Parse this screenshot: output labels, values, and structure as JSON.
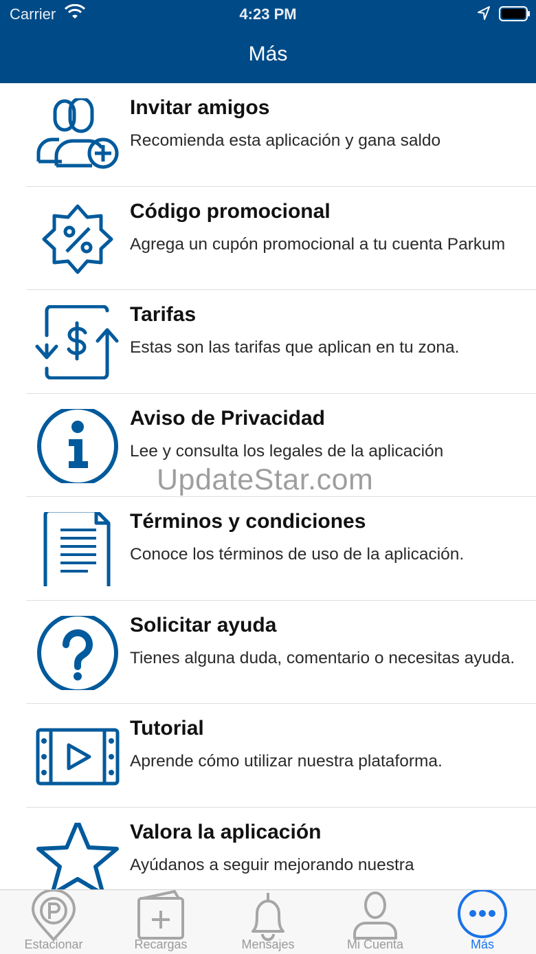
{
  "status": {
    "carrier": "Carrier",
    "time": "4:23 PM"
  },
  "header": {
    "title": "Más"
  },
  "watermark": "UpdateStar.com",
  "colors": {
    "header": "#004b87",
    "icon": "#005a9c",
    "active_tab": "#1a73e8"
  },
  "items": [
    {
      "title": "Invitar amigos",
      "subtitle": "Recomienda esta aplicación y gana saldo",
      "icon": "users-add-icon"
    },
    {
      "title": "Código promocional",
      "subtitle": "Agrega un cupón promocional a tu cuenta Parkum",
      "icon": "percent-badge-icon"
    },
    {
      "title": "Tarifas",
      "subtitle": "Estas son las tarifas que aplican en tu zona.",
      "icon": "rates-icon"
    },
    {
      "title": "Aviso de Privacidad",
      "subtitle": "Lee y consulta los legales de la aplicación",
      "icon": "info-icon"
    },
    {
      "title": "Términos y condiciones",
      "subtitle": "Conoce los términos de uso de la aplicación.",
      "icon": "document-icon"
    },
    {
      "title": "Solicitar ayuda",
      "subtitle": "Tienes alguna duda, comentario o necesitas ayuda.",
      "icon": "help-icon"
    },
    {
      "title": "Tutorial",
      "subtitle": "Aprende cómo utilizar nuestra plataforma.",
      "icon": "video-icon"
    },
    {
      "title": "Valora la aplicación",
      "subtitle": "Ayúdanos a seguir mejorando nuestra",
      "icon": "star-icon"
    }
  ],
  "tabs": [
    {
      "label": "Estacionar",
      "icon": "parking-pin-icon"
    },
    {
      "label": "Recargas",
      "icon": "wallet-add-icon"
    },
    {
      "label": "Mensajes",
      "icon": "bell-icon"
    },
    {
      "label": "Mi Cuenta",
      "icon": "user-icon"
    },
    {
      "label": "Más",
      "icon": "more-icon",
      "active": true
    }
  ]
}
